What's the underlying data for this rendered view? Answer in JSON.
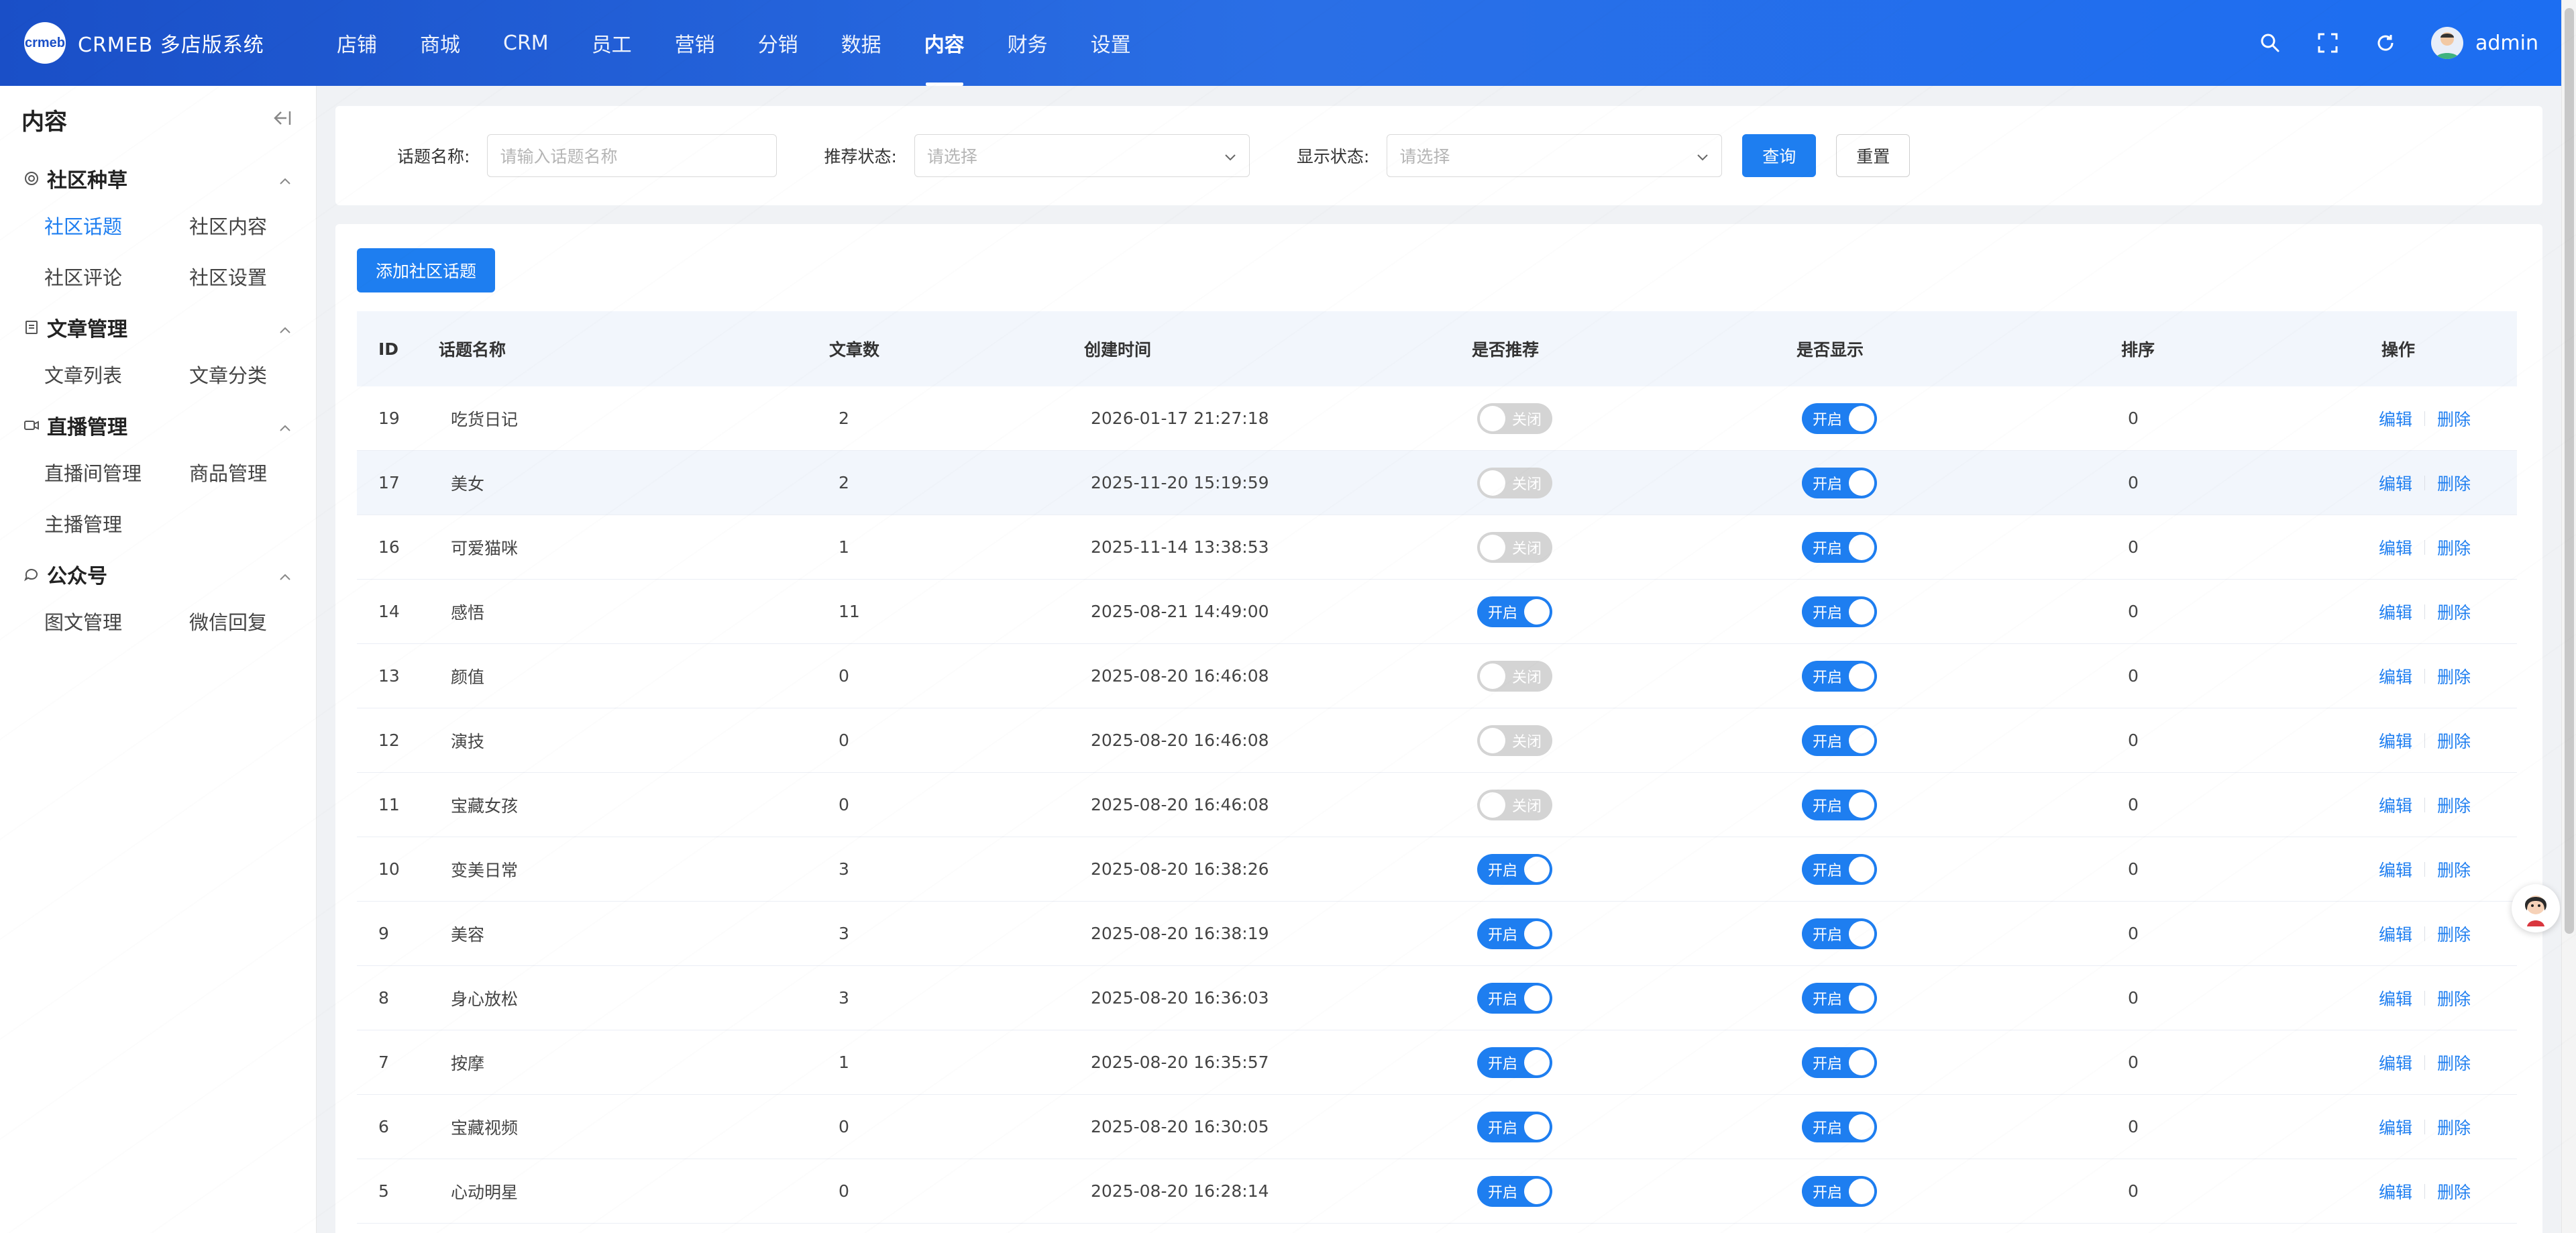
{
  "header": {
    "logo_mark": "crmeb",
    "logo_text": "CRMEB 多店版系统",
    "nav": [
      {
        "label": "店铺"
      },
      {
        "label": "商城"
      },
      {
        "label": "CRM"
      },
      {
        "label": "员工"
      },
      {
        "label": "营销"
      },
      {
        "label": "分销"
      },
      {
        "label": "数据"
      },
      {
        "label": "内容",
        "active": true
      },
      {
        "label": "财务"
      },
      {
        "label": "设置"
      }
    ],
    "icons": [
      "search-icon",
      "fullscreen-icon",
      "refresh-icon"
    ],
    "user_name": "admin"
  },
  "sidebar": {
    "title": "内容",
    "sections": [
      {
        "title": "社区种草",
        "icon": "circle-target-icon",
        "items": [
          "社区话题",
          "社区内容",
          "社区评论",
          "社区设置"
        ],
        "active": "社区话题"
      },
      {
        "title": "文章管理",
        "icon": "document-icon",
        "items": [
          "文章列表",
          "文章分类"
        ]
      },
      {
        "title": "直播管理",
        "icon": "video-icon",
        "items": [
          "直播间管理",
          "商品管理",
          "主播管理"
        ]
      },
      {
        "title": "公众号",
        "icon": "chat-bubble-icon",
        "items": [
          "图文管理",
          "微信回复"
        ]
      }
    ]
  },
  "filter": {
    "topic_label": "话题名称:",
    "topic_placeholder": "请输入话题名称",
    "recommend_label": "推荐状态:",
    "recommend_placeholder": "请选择",
    "display_label": "显示状态:",
    "display_placeholder": "请选择",
    "query_button": "查询",
    "reset_button": "重置"
  },
  "table": {
    "add_button": "添加社区话题",
    "columns": [
      "ID",
      "话题名称",
      "文章数",
      "创建时间",
      "是否推荐",
      "是否显示",
      "排序",
      "操作"
    ],
    "switch_on_label": "开启",
    "switch_off_label": "关闭",
    "edit_label": "编辑",
    "delete_label": "删除",
    "rows": [
      {
        "id": "19",
        "name": "吃货日记",
        "count": "2",
        "time": "2026-01-17 21:27:18",
        "recommend": false,
        "show": true,
        "sort": "0"
      },
      {
        "id": "17",
        "name": "美女",
        "count": "2",
        "time": "2025-11-20 15:19:59",
        "recommend": false,
        "show": true,
        "sort": "0"
      },
      {
        "id": "16",
        "name": "可爱猫咪",
        "count": "1",
        "time": "2025-11-14 13:38:53",
        "recommend": false,
        "show": true,
        "sort": "0"
      },
      {
        "id": "14",
        "name": "感悟",
        "count": "11",
        "time": "2025-08-21 14:49:00",
        "recommend": true,
        "show": true,
        "sort": "0"
      },
      {
        "id": "13",
        "name": "颜值",
        "count": "0",
        "time": "2025-08-20 16:46:08",
        "recommend": false,
        "show": true,
        "sort": "0"
      },
      {
        "id": "12",
        "name": "演技",
        "count": "0",
        "time": "2025-08-20 16:46:08",
        "recommend": false,
        "show": true,
        "sort": "0"
      },
      {
        "id": "11",
        "name": "宝藏女孩",
        "count": "0",
        "time": "2025-08-20 16:46:08",
        "recommend": false,
        "show": true,
        "sort": "0"
      },
      {
        "id": "10",
        "name": "变美日常",
        "count": "3",
        "time": "2025-08-20 16:38:26",
        "recommend": true,
        "show": true,
        "sort": "0"
      },
      {
        "id": "9",
        "name": "美容",
        "count": "3",
        "time": "2025-08-20 16:38:19",
        "recommend": true,
        "show": true,
        "sort": "0"
      },
      {
        "id": "8",
        "name": "身心放松",
        "count": "3",
        "time": "2025-08-20 16:36:03",
        "recommend": true,
        "show": true,
        "sort": "0"
      },
      {
        "id": "7",
        "name": "按摩",
        "count": "1",
        "time": "2025-08-20 16:35:57",
        "recommend": true,
        "show": true,
        "sort": "0"
      },
      {
        "id": "6",
        "name": "宝藏视频",
        "count": "0",
        "time": "2025-08-20 16:30:05",
        "recommend": true,
        "show": true,
        "sort": "0"
      },
      {
        "id": "5",
        "name": "心动明星",
        "count": "0",
        "time": "2025-08-20 16:28:14",
        "recommend": true,
        "show": true,
        "sort": "0"
      }
    ]
  },
  "colors": {
    "primary": "#1e7ef0",
    "header_from": "#1a4fc7",
    "header_to": "#1c6ef2",
    "switch_off": "#d4d4d4"
  }
}
